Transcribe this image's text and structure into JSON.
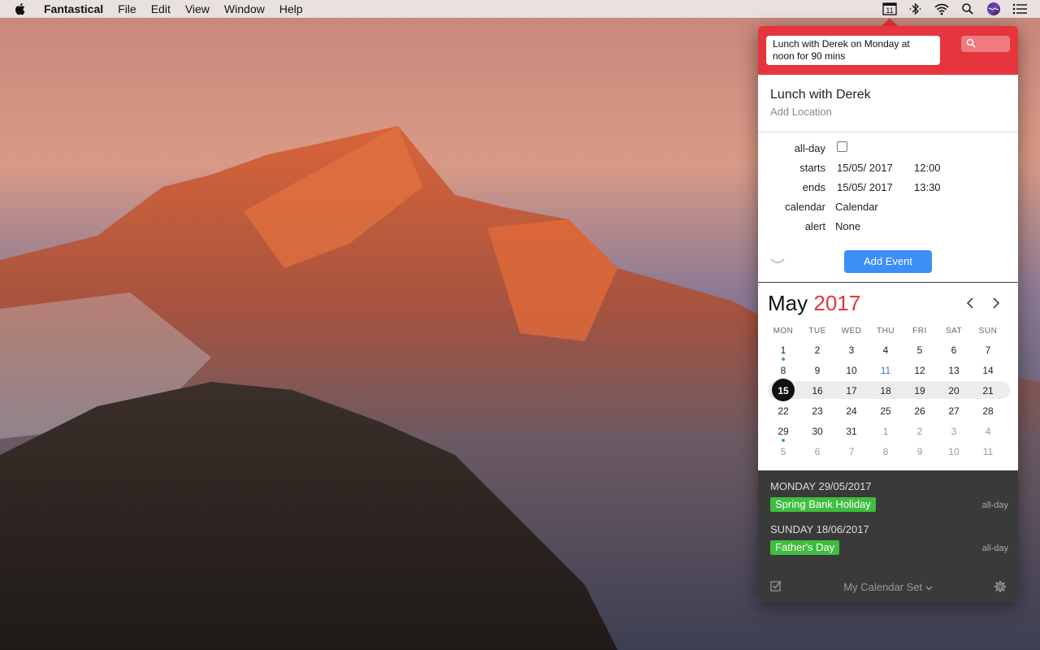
{
  "menubar": {
    "app_name": "Fantastical",
    "items": [
      "File",
      "Edit",
      "View",
      "Window",
      "Help"
    ],
    "calendar_icon_day": "11"
  },
  "popover": {
    "input_text": "Lunch with Derek on Monday at noon for 90 mins",
    "event": {
      "title": "Lunch with Derek",
      "location_placeholder": "Add Location",
      "allday_label": "all-day",
      "starts_label": "starts",
      "starts_date": "15/05/ 2017",
      "starts_time": "12:00",
      "ends_label": "ends",
      "ends_date": "15/05/ 2017",
      "ends_time": "13:30",
      "calendar_label": "calendar",
      "calendar_value": "Calendar",
      "alert_label": "alert",
      "alert_value": "None",
      "add_button": "Add Event"
    },
    "calendar": {
      "month": "May",
      "year": "2017",
      "weekdays": [
        "MON",
        "TUE",
        "WED",
        "THU",
        "FRI",
        "SAT",
        "SUN"
      ],
      "weeks": [
        [
          "1",
          "2",
          "3",
          "4",
          "5",
          "6",
          "7"
        ],
        [
          "8",
          "9",
          "10",
          "11",
          "12",
          "13",
          "14"
        ],
        [
          "15",
          "16",
          "17",
          "18",
          "19",
          "20",
          "21"
        ],
        [
          "22",
          "23",
          "24",
          "25",
          "26",
          "27",
          "28"
        ],
        [
          "29",
          "30",
          "31",
          "1",
          "2",
          "3",
          "4"
        ],
        [
          "5",
          "6",
          "7",
          "8",
          "9",
          "10",
          "11"
        ]
      ],
      "selected_day": "15",
      "today": "11"
    },
    "upcoming": [
      {
        "date": "MONDAY 29/05/2017",
        "name": "Spring Bank Holiday",
        "when": "all-day"
      },
      {
        "date": "SUNDAY 18/06/2017",
        "name": "Father's Day",
        "when": "all-day"
      }
    ],
    "footer": {
      "calendar_set": "My Calendar Set"
    }
  },
  "colors": {
    "accent_red": "#e5353d",
    "button_blue": "#3b8ff7",
    "event_green": "#3fbd3f"
  }
}
